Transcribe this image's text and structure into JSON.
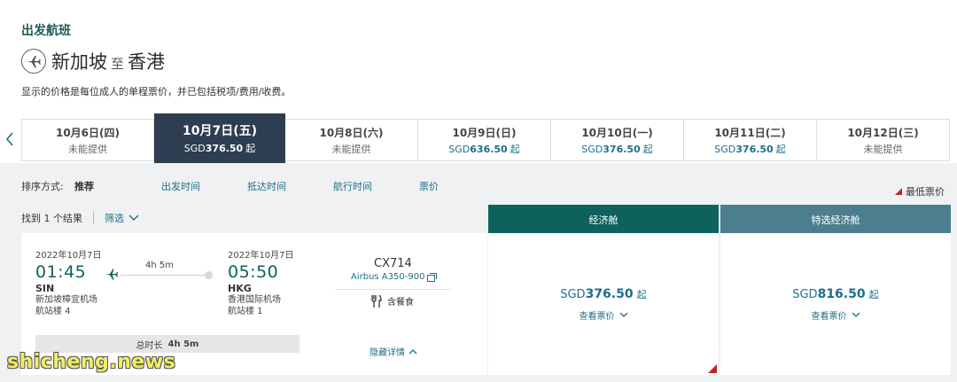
{
  "header": {
    "section_title": "出发航班",
    "icon": "airplane-icon",
    "origin": "新加坡",
    "separator": "至",
    "destination": "香港",
    "price_note": "显示的价格是每位成人的单程票价，并已包括税项/费用/收费。"
  },
  "date_tabs": [
    {
      "date": "10月6日(四)",
      "price_prefix": "",
      "price": "未能提供",
      "suffix": "",
      "active": false
    },
    {
      "date": "10月7日(五)",
      "price_prefix": "SGD",
      "price": "376.50",
      "suffix": "起",
      "active": true
    },
    {
      "date": "10月8日(六)",
      "price_prefix": "",
      "price": "未能提供",
      "suffix": "",
      "active": false
    },
    {
      "date": "10月9日(日)",
      "price_prefix": "SGD",
      "price": "636.50",
      "suffix": "起",
      "active": false
    },
    {
      "date": "10月10日(一)",
      "price_prefix": "SGD",
      "price": "376.50",
      "suffix": "起",
      "active": false
    },
    {
      "date": "10月11日(二)",
      "price_prefix": "SGD",
      "price": "376.50",
      "suffix": "起",
      "active": false
    },
    {
      "date": "10月12日(三)",
      "price_prefix": "",
      "price": "未能提供",
      "suffix": "",
      "active": false
    }
  ],
  "sort": {
    "label": "排序方式:",
    "options": [
      "推荐",
      "出发时间",
      "抵达时间",
      "航行时间",
      "票价"
    ],
    "selected": "推荐",
    "lowest_fare_label": "最低票价"
  },
  "results": {
    "found_label": "找到 1 个结果",
    "filter_label": "筛选"
  },
  "cabins": {
    "economy": "经济舱",
    "premium_economy": "特选经济舱"
  },
  "flight": {
    "departure": {
      "date": "2022年10月7日",
      "time": "01:45",
      "code": "SIN",
      "airport": "新加坡樟宜机场",
      "terminal": "航站楼 4"
    },
    "arrival": {
      "date": "2022年10月7日",
      "time": "05:50",
      "code": "HKG",
      "airport": "香港国际机场",
      "terminal": "航站楼 1"
    },
    "duration": "4h 5m",
    "flight_number": "CX714",
    "aircraft": "Airbus A350-900",
    "meal": "含餐食",
    "total_label": "总时长",
    "total_value": "4h 5m",
    "hide_details": "隐藏详情"
  },
  "fares": {
    "economy": {
      "currency": "SGD",
      "amount": "376.50",
      "suffix": "起",
      "link": "查看票价"
    },
    "premium_economy": {
      "currency": "SGD",
      "amount": "816.50",
      "suffix": "起",
      "link": "查看票价"
    }
  },
  "watermark": "shicheng.news",
  "colors": {
    "brand_green": "#0e625c",
    "premium_teal": "#4b7f8f",
    "active_tab": "#2c3e50",
    "link_blue": "#1e6f8a",
    "lowest_fare_red": "#c0232b"
  }
}
